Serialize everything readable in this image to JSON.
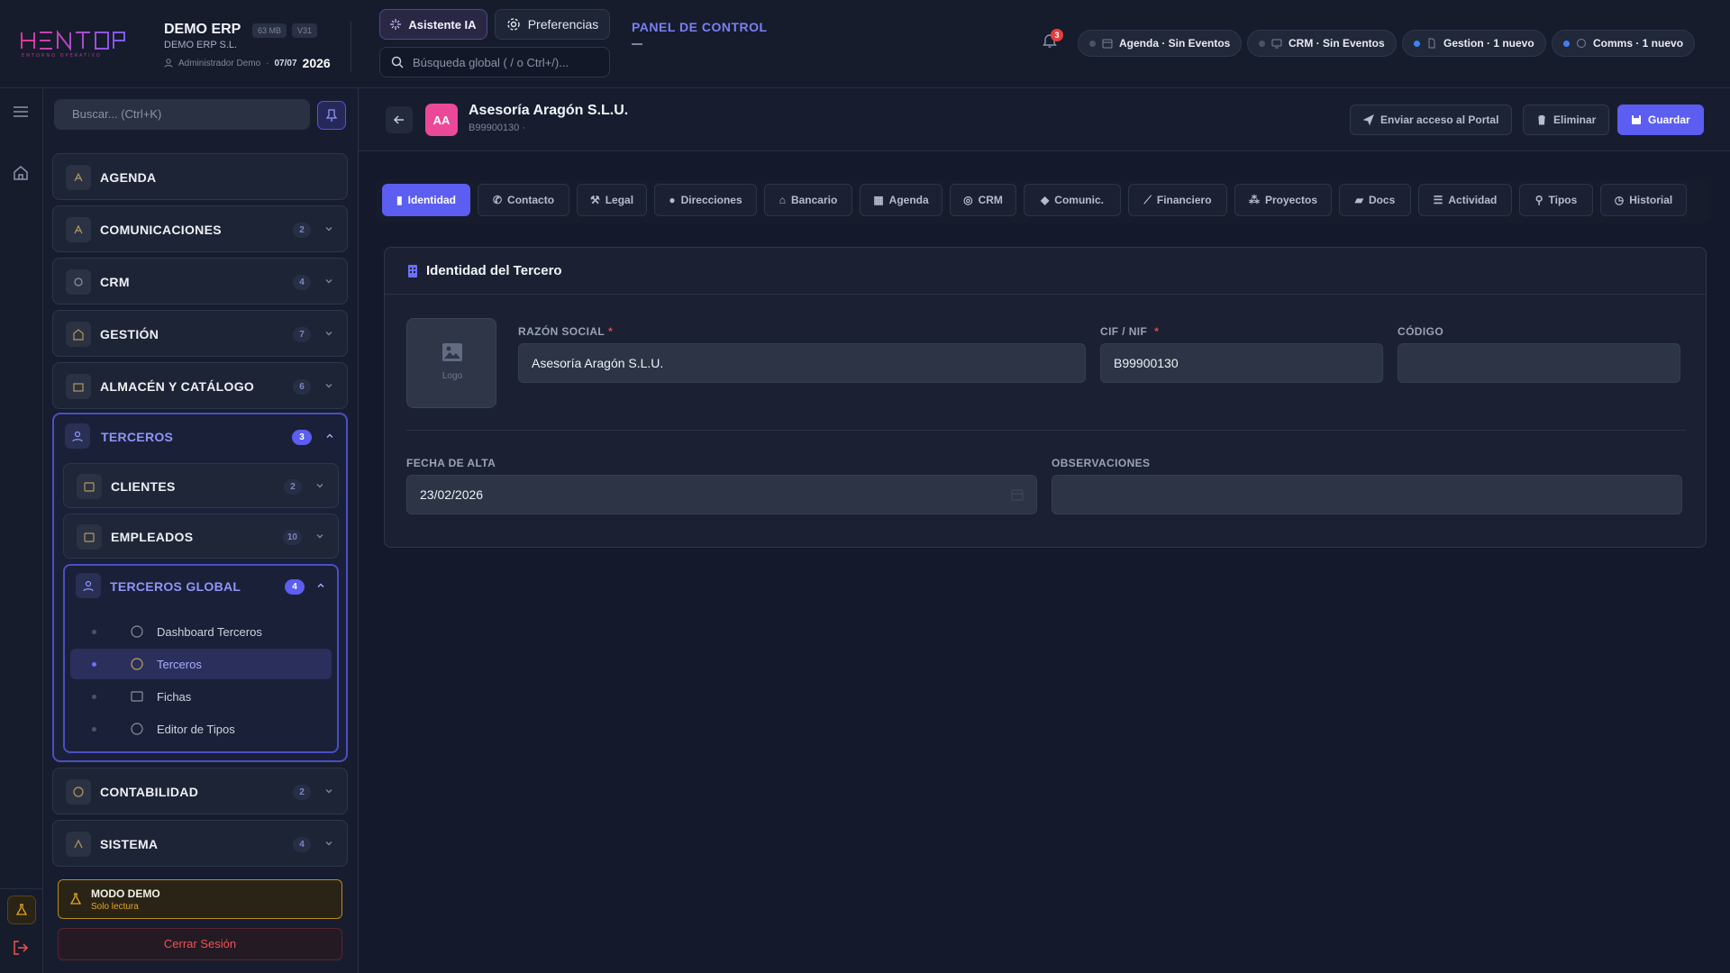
{
  "brand": {
    "name": "DEMO ERP",
    "size_pill": "63 MB",
    "version_pill": "V31",
    "company": "DEMO ERP S.L.",
    "user": "Administrador Demo",
    "date": "07/07",
    "year": "2026"
  },
  "topbar": {
    "ai_button": "Asistente IA",
    "prefs_button": "Preferencias",
    "search_placeholder": "Búsqueda global ( / o Ctrl+/)...",
    "panel_title": "PANEL DE CONTROL",
    "notifications_count": "3",
    "status_pills": [
      {
        "label": "Agenda · Sin Eventos",
        "dot": "#4a5269"
      },
      {
        "label": "CRM · Sin Eventos",
        "dot": "#4a5269"
      },
      {
        "label": "Gestion · 1 nuevo",
        "dot": "#3b82f6"
      },
      {
        "label": "Comms · 1 nuevo",
        "dot": "#3b82f6"
      }
    ]
  },
  "sidebar": {
    "search_placeholder": "Buscar... (Ctrl+K)",
    "sections": [
      {
        "label": "AGENDA",
        "badge": ""
      },
      {
        "label": "COMUNICACIONES",
        "badge": "2"
      },
      {
        "label": "CRM",
        "badge": "4"
      },
      {
        "label": "GESTIÓN",
        "badge": "7"
      },
      {
        "label": "ALMACÉN Y CATÁLOGO",
        "badge": "6"
      }
    ],
    "terceros": {
      "label": "TERCEROS",
      "badge": "3",
      "subs": [
        {
          "label": "CLIENTES",
          "badge": "2"
        },
        {
          "label": "EMPLEADOS",
          "badge": "10"
        }
      ],
      "global": {
        "label": "TERCEROS GLOBAL",
        "badge": "4",
        "items": [
          "Dashboard Terceros",
          "Terceros",
          "Fichas",
          "Editor de Tipos"
        ]
      }
    },
    "bottom_sections": [
      {
        "label": "CONTABILIDAD",
        "badge": "2"
      },
      {
        "label": "SISTEMA",
        "badge": "4"
      }
    ],
    "demo_mode": {
      "title": "MODO DEMO",
      "subtitle": "Solo lectura"
    },
    "logout": "Cerrar Sesión"
  },
  "header": {
    "avatar": "AA",
    "name": "Asesoría Aragón S.L.U.",
    "sub": "B99900130 ·",
    "portal_button": "Enviar acceso al Portal",
    "delete_button": "Eliminar",
    "save_button": "Guardar"
  },
  "tabs": [
    "Identidad",
    "Contacto",
    "Legal",
    "Direcciones",
    "Bancario",
    "Agenda",
    "CRM",
    "Comunic.",
    "Financiero",
    "Proyectos",
    "Docs",
    "Actividad",
    "Tipos",
    "Historial"
  ],
  "form": {
    "title": "Identidad del Tercero",
    "logo_label": "Logo",
    "razon_label": "RAZÓN SOCIAL",
    "razon_value": "Asesoría Aragón S.L.U.",
    "cif_label": "CIF / NIF",
    "cif_value": "B99900130",
    "codigo_label": "CÓDIGO",
    "codigo_value": "",
    "fecha_label": "FECHA DE ALTA",
    "fecha_value": "23/02/2026",
    "obs_label": "OBSERVACIONES",
    "obs_value": "",
    "required_mark": "*"
  },
  "colors": {
    "accent": "#5b5ef0",
    "avatar": "#ec4899",
    "warning": "#e4a521",
    "danger": "#f05252"
  }
}
